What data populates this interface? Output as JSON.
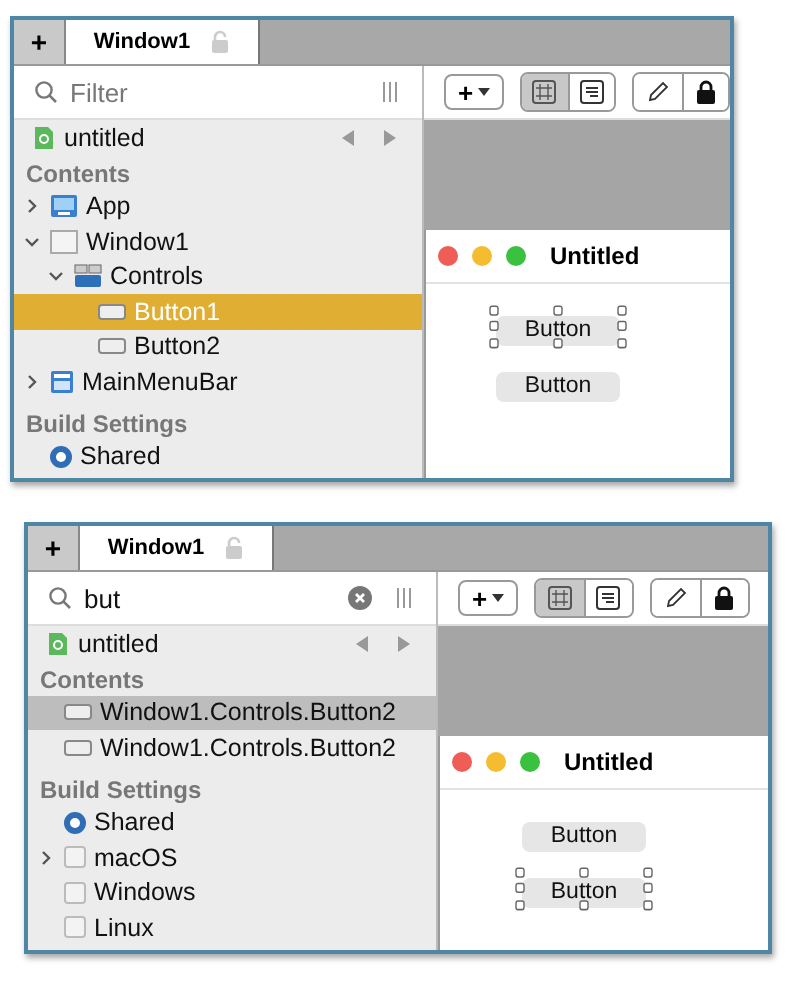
{
  "panels": [
    {
      "add_tab": "+",
      "tab": {
        "title": "Window1",
        "locked": false
      },
      "filter": {
        "placeholder": "Filter"
      },
      "project": "untitled",
      "contents_heading": "Contents",
      "list_focused": true,
      "toolbar": {
        "add": "+",
        "views": [
          {
            "kind": "grid",
            "selected": true
          },
          {
            "kind": "list",
            "selected": false
          }
        ]
      },
      "tree": [
        {
          "label": "App",
          "kind": "app",
          "expanded": false,
          "selected": false
        },
        {
          "label": "Window1",
          "kind": "window",
          "expanded": true,
          "selected": false,
          "children": [
            {
              "label": "Controls",
              "kind": "controls",
              "expanded": true,
              "selected": false,
              "children": [
                {
                  "label": "Button1",
                  "kind": "button",
                  "selected": true
                },
                {
                  "label": "Button2",
                  "kind": "button",
                  "selected": false
                }
              ]
            }
          ]
        },
        {
          "label": "MainMenuBar",
          "kind": "menubar",
          "expanded": false,
          "selected": false
        }
      ],
      "build_heading": "Build Settings",
      "build_settings": [
        {
          "label": "Shared",
          "kind": "radio",
          "selected": true
        }
      ],
      "canvas": {
        "window_title": "Untitled",
        "buttons": [
          {
            "label": "Button",
            "selected": true
          },
          {
            "label": "Button",
            "selected": false
          }
        ]
      }
    },
    {
      "add_tab": "+",
      "tab": {
        "title": "Window1",
        "locked": false
      },
      "filter": {
        "value": "but"
      },
      "project": "untitled",
      "contents_heading": "Contents",
      "list_focused": false,
      "toolbar": {
        "add": "+",
        "views": [
          {
            "kind": "grid",
            "selected": true
          },
          {
            "kind": "list",
            "selected": false
          }
        ]
      },
      "tree": [
        {
          "label": "Window1.Controls.Button2",
          "kind": "button",
          "selected": true
        },
        {
          "label": "Window1.Controls.Button2",
          "kind": "button",
          "selected": false
        }
      ],
      "build_heading": "Build Settings",
      "build_settings": [
        {
          "label": "Shared",
          "kind": "radio",
          "selected": true
        },
        {
          "label": "macOS",
          "kind": "checkbox",
          "checked": false,
          "expanded": false
        },
        {
          "label": "Windows",
          "kind": "checkbox",
          "checked": false
        },
        {
          "label": "Linux",
          "kind": "checkbox",
          "checked": false
        }
      ],
      "canvas": {
        "window_title": "Untitled",
        "buttons": [
          {
            "label": "Button",
            "selected": false
          },
          {
            "label": "Button",
            "selected": true
          }
        ]
      }
    }
  ]
}
